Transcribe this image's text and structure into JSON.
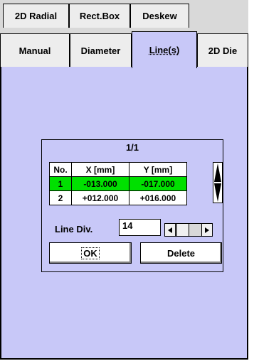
{
  "tabs_row1": [
    {
      "label": "2D Radial"
    },
    {
      "label": "Rect.Box"
    },
    {
      "label": "Deskew"
    }
  ],
  "tabs_row2": [
    {
      "label": "Manual"
    },
    {
      "label": "Diameter"
    },
    {
      "label": "Line(s)",
      "active": true
    },
    {
      "label": "2D Die"
    }
  ],
  "dialog": {
    "page": "1/1",
    "columns": [
      "No.",
      "X [mm]",
      "Y [mm]"
    ],
    "rows": [
      {
        "no": "1",
        "x": "-013.000",
        "y": "-017.000",
        "selected": true
      },
      {
        "no": "2",
        "x": "+012.000",
        "y": "+016.000",
        "selected": false
      }
    ],
    "line_div_label": "Line Div.",
    "line_div_value": "14",
    "ok_label": "OK",
    "delete_label": "Delete"
  },
  "colors": {
    "background": "#c8c8f8",
    "selected_row": "#00e000"
  }
}
